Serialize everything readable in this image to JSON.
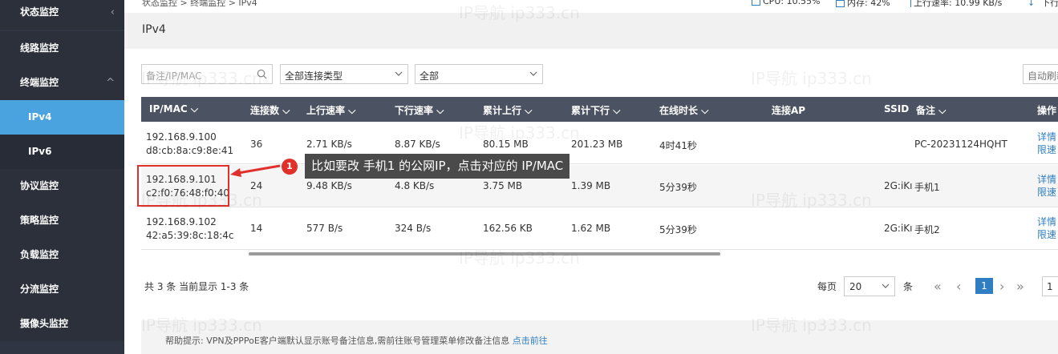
{
  "sidebar": {
    "items": [
      {
        "label": "状态监控",
        "chevron": "‹"
      },
      {
        "label": "线路监控"
      },
      {
        "label": "终端监控",
        "chevron": "^"
      },
      {
        "label": "IPv4"
      },
      {
        "label": "IPv6"
      },
      {
        "label": "协议监控"
      },
      {
        "label": "策略监控"
      },
      {
        "label": "负载监控"
      },
      {
        "label": "分流监控"
      },
      {
        "label": "摄像头监控"
      }
    ]
  },
  "topbar": {
    "breadcrumb": "状态监控 > 终端监控 > IPv4",
    "cpu": "CPU: 10.55%",
    "mem": "内存: 42%",
    "upload": "上行速率: 10.99 KB/s",
    "download": "下行"
  },
  "page": {
    "title": "IPv4"
  },
  "filters": {
    "search_placeholder": "备注/IP/MAC",
    "conn_type": "全部连接类型",
    "scope": "全部",
    "refresh": "自动刷新"
  },
  "table": {
    "headers": {
      "ipmac": "IP/MAC",
      "conns": "连接数",
      "up_rate": "上行速率",
      "down_rate": "下行速率",
      "up_total": "累计上行",
      "down_total": "累计下行",
      "online": "在线时长",
      "ap": "连接AP",
      "ssid": "SSID",
      "note": "备注",
      "ops": "操作"
    },
    "rows": [
      {
        "ip": "192.168.9.100",
        "mac": "d8:cb:8a:c9:8e:41",
        "conns": "36",
        "up_rate": "2.71 KB/s",
        "down_rate": "8.87 KB/s",
        "up_total": "80.15 MB",
        "down_total": "201.23 MB",
        "online": "4时41秒",
        "ssid": "",
        "note": "PC-20231124HQHT",
        "op1": "详情",
        "op2": "限速"
      },
      {
        "ip": "192.168.9.101",
        "mac": "c2:f0:76:48:f0:40",
        "conns": "24",
        "up_rate": "9.48 KB/s",
        "down_rate": "4.8 KB/s",
        "up_total": "3.75 MB",
        "down_total": "1.39 MB",
        "online": "5分39秒",
        "ssid": "2G:iKı",
        "note": "手机1",
        "op1": "详情",
        "op2": "限速"
      },
      {
        "ip": "192.168.9.102",
        "mac": "42:a5:39:8c:18:4c",
        "conns": "14",
        "up_rate": "577 B/s",
        "down_rate": "324 B/s",
        "up_total": "162.56 KB",
        "down_total": "1.62 MB",
        "online": "5分39秒",
        "ssid": "2G:iKı",
        "note": "手机2",
        "op1": "详情",
        "op2": "限速"
      }
    ]
  },
  "annotation": {
    "badge": "1",
    "tip": "比如要改 手机1 的公网IP，点击对应的 IP/MAC"
  },
  "pager": {
    "summary": "共 3 条 当前显示 1-3 条",
    "per_page_label": "每页",
    "per_page": "20",
    "unit": "条",
    "current": "1",
    "jump": "1"
  },
  "help": {
    "text": "帮助提示:  VPN及PPPoE客户端默认显示账号备注信息,需前往账号管理菜单修改备注信息",
    "link": "点击前往"
  },
  "watermark": "IP导航  ip333.cn",
  "colors": {
    "sidebar": "#2f3542",
    "active": "#4aa3df",
    "header": "#4b5261",
    "link": "#2f7ec1",
    "highlight": "#e0302b"
  }
}
